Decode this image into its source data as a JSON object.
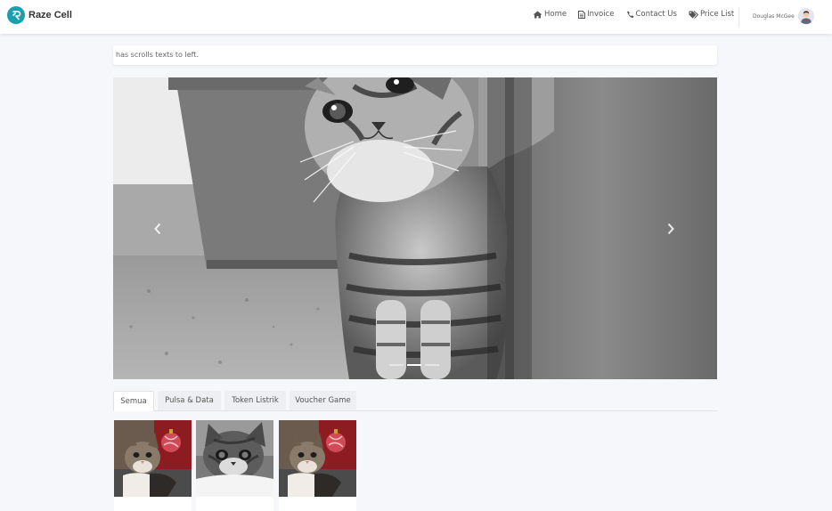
{
  "brand": {
    "name": "Raze Cell",
    "color": "#1a9fb0"
  },
  "nav": {
    "items": [
      {
        "label": "Home",
        "icon": "home-icon"
      },
      {
        "label": "Invoice",
        "icon": "file-icon"
      },
      {
        "label": "Contact Us",
        "icon": "phone-icon"
      },
      {
        "label": "Price List",
        "icon": "tags-icon"
      }
    ],
    "user": {
      "name": "Douglas McGee",
      "icon": "avatar-icon"
    }
  },
  "marquee": {
    "text": "has scrolls texts to left."
  },
  "carousel": {
    "slide_count": 3,
    "active_index": 1,
    "prev_icon": "chevron-left-icon",
    "next_icon": "chevron-right-icon"
  },
  "tabs": [
    {
      "label": "Semua",
      "active": true
    },
    {
      "label": "Pulsa & Data",
      "active": false
    },
    {
      "label": "Token Listrik",
      "active": false
    },
    {
      "label": "Voucher Game",
      "active": false
    }
  ],
  "products": [
    {
      "image": "kitten-with-red-ornament"
    },
    {
      "image": "grey-kitten-on-white"
    },
    {
      "image": "kitten-with-red-ornament"
    }
  ]
}
